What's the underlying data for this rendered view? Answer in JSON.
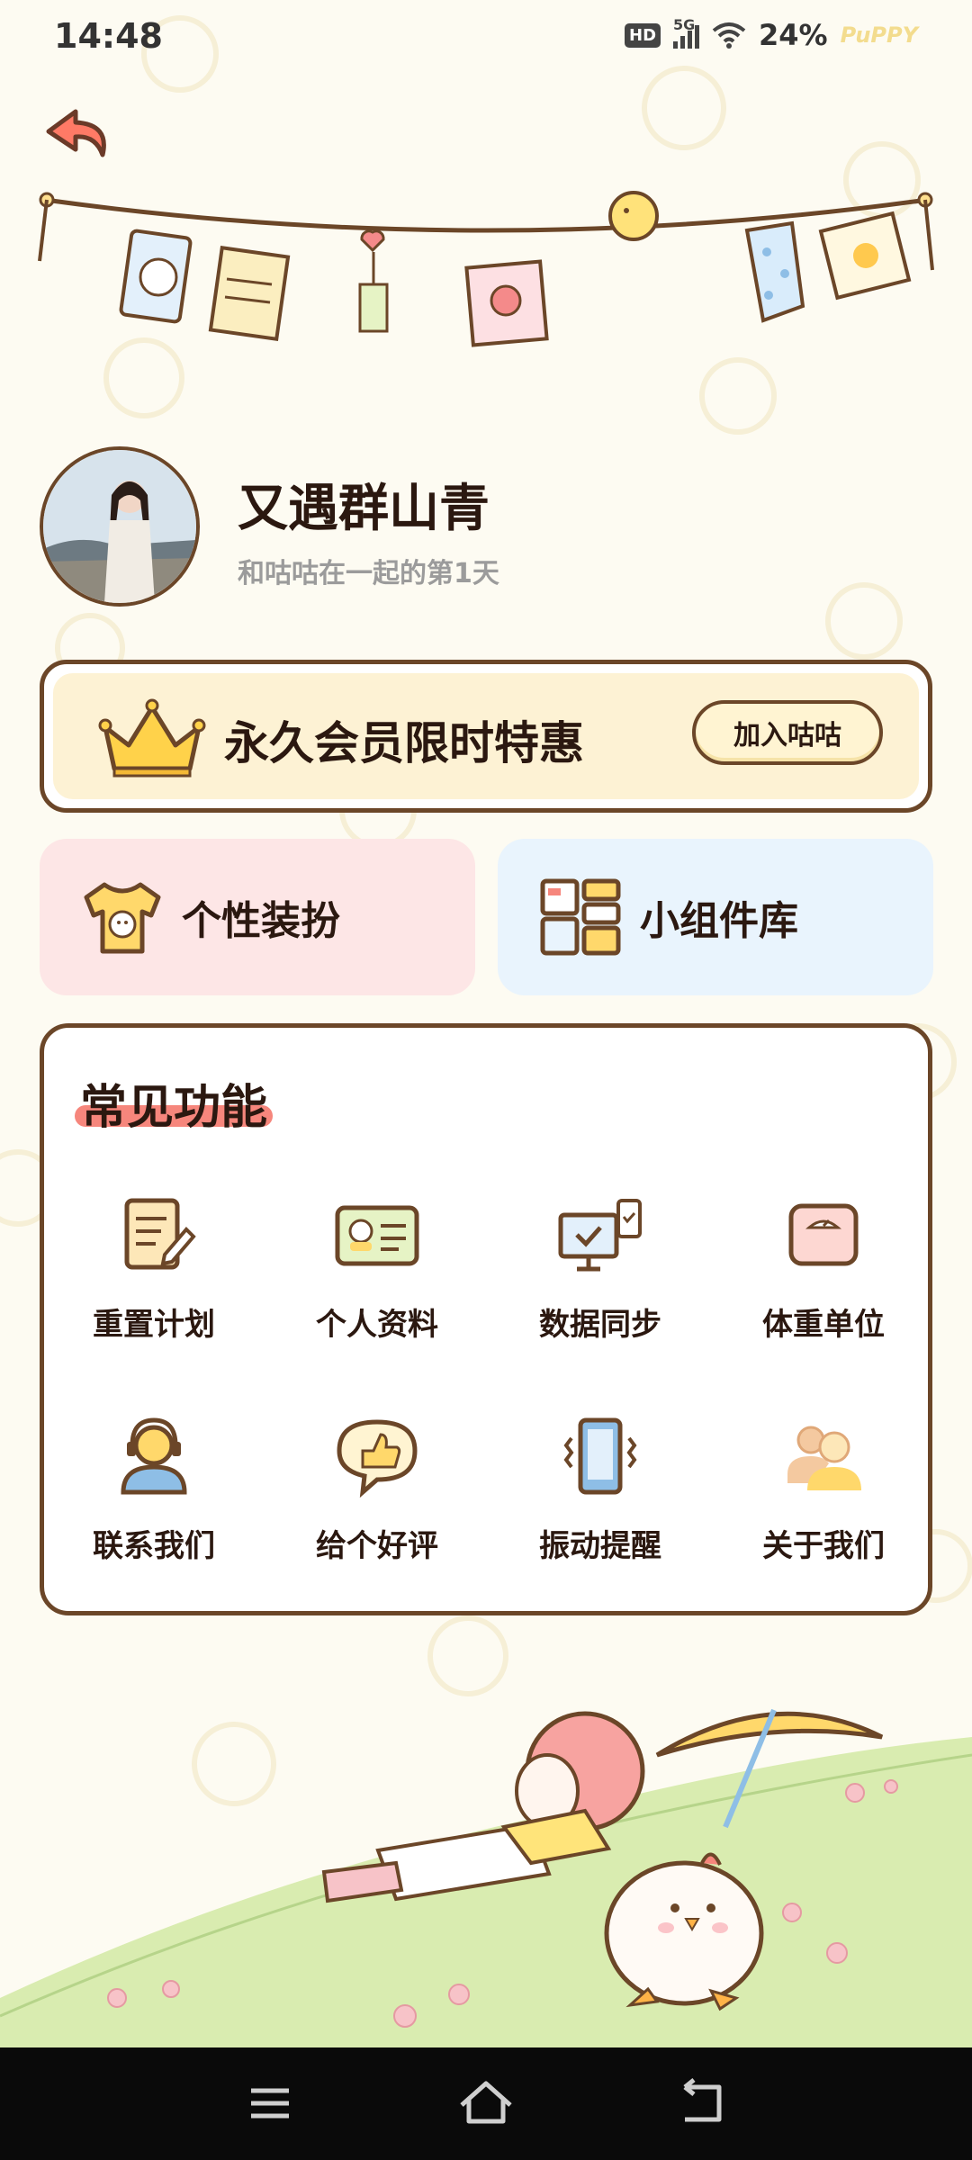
{
  "status_bar": {
    "time": "14:48",
    "hd_badge": "HD",
    "network": "5G",
    "battery": "24%",
    "carrier_mark": "PuPPY"
  },
  "header": {
    "back_icon": "undo-arrow-icon"
  },
  "profile": {
    "username": "又遇群山青",
    "days_together": "和咕咕在一起的第1天"
  },
  "membership": {
    "title": "永久会员限时特惠",
    "join_label": "加入咕咕"
  },
  "quick_cards": [
    {
      "label": "个性装扮",
      "icon": "tshirt-icon"
    },
    {
      "label": "小组件库",
      "icon": "widgets-icon"
    }
  ],
  "functions": {
    "title": "常见功能",
    "items": [
      {
        "label": "重置计划",
        "icon": "document-pen-icon"
      },
      {
        "label": "个人资料",
        "icon": "id-card-icon"
      },
      {
        "label": "数据同步",
        "icon": "computer-sync-icon"
      },
      {
        "label": "体重单位",
        "icon": "scale-icon"
      },
      {
        "label": "联系我们",
        "icon": "headset-support-icon"
      },
      {
        "label": "给个好评",
        "icon": "thumbs-up-icon"
      },
      {
        "label": "振动提醒",
        "icon": "phone-vibrate-icon"
      },
      {
        "label": "关于我们",
        "icon": "people-icon"
      }
    ]
  },
  "colors": {
    "brown_outline": "#6b4628",
    "background": "#fdfbf2",
    "accent_red": "#f6867c",
    "pink_card": "#fde6e6",
    "blue_card": "#e9f4fd",
    "member_bg": "#fdf2d4"
  }
}
